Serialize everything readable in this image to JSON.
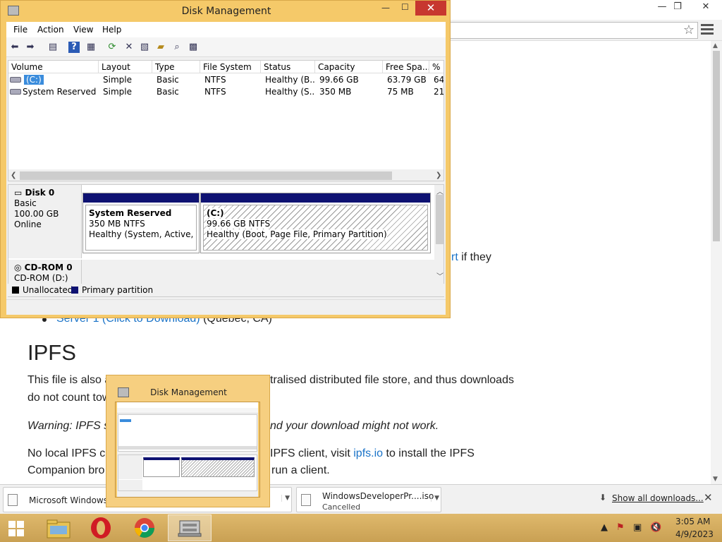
{
  "browser": {
    "page": {
      "paren": ")",
      "link_tail": "rt",
      "after_link": " if they",
      "server_link": "Server 1 (Click to Download)",
      "server_location": " (Quebec, CA)",
      "ipfs_heading": "IPFS",
      "para1_start": "This file is also a",
      "para1_end": "tralised distributed file store, and thus downloads",
      "para1b_start": "do not count tow",
      "warn_start": "Warning: IPFS su",
      "warn_end": "nd your download might not work.",
      "para2_start": "No local IPFS cli",
      "para2_mid": "IPFS client, visit ",
      "para2_link": "ipfs.io",
      "para2_end": " to install the IPFS",
      "para2b_start": "Companion bro",
      "para2b_end": "run a client."
    }
  },
  "downloads": {
    "items": [
      {
        "name": "Microsoft Windows I",
        "status": ""
      },
      {
        "name": "WindowsDeveloperPr....iso",
        "status": "Cancelled"
      }
    ],
    "show_all": "Show all downloads...",
    "close": "✕"
  },
  "disk_mgmt": {
    "title": "Disk Management",
    "menu": [
      "File",
      "Action",
      "View",
      "Help"
    ],
    "columns": [
      "Volume",
      "Layout",
      "Type",
      "File System",
      "Status",
      "Capacity",
      "Free Spa...",
      "% F"
    ],
    "volumes": [
      {
        "volume": "(C:)",
        "layout": "Simple",
        "type": "Basic",
        "fs": "NTFS",
        "status": "Healthy (B...",
        "capacity": "99.66 GB",
        "free": "63.79 GB",
        "pct": "64"
      },
      {
        "volume": "System Reserved",
        "layout": "Simple",
        "type": "Basic",
        "fs": "NTFS",
        "status": "Healthy (S...",
        "capacity": "350 MB",
        "free": "75 MB",
        "pct": "21"
      }
    ],
    "disk0": {
      "name": "Disk 0",
      "type": "Basic",
      "size": "100.00 GB",
      "state": "Online"
    },
    "partitions": [
      {
        "name": "System Reserved",
        "size": "350 MB NTFS",
        "status": "Healthy (System, Active, Prin"
      },
      {
        "name": "(C:)",
        "size": "99.66 GB NTFS",
        "status": "Healthy (Boot, Page File, Primary Partition)"
      }
    ],
    "cdrom": {
      "name": "CD-ROM 0",
      "drive": "CD-ROM (D:)"
    },
    "legend": {
      "unallocated": "Unallocated",
      "primary": "Primary partition"
    },
    "colors": {
      "primary": "#0e1272",
      "unallocated": "#000000",
      "title_bg": "#f5c969"
    }
  },
  "thumbnail": {
    "title": "Disk Management"
  },
  "taskbar": {
    "time": "3:05 AM",
    "date": "4/9/2023",
    "apps": [
      "file-explorer-icon",
      "opera-icon",
      "chrome-icon",
      "disk-management-icon"
    ]
  }
}
